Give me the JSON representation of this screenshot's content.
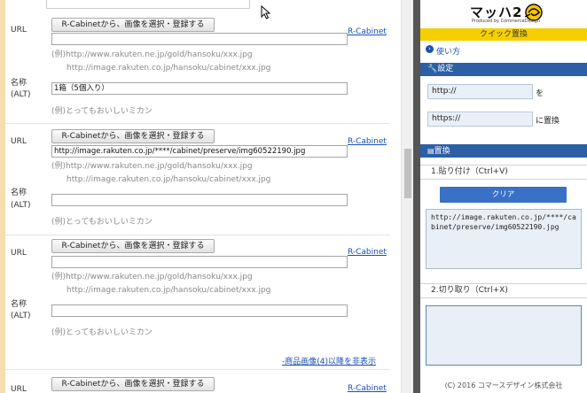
{
  "left": {
    "url_label": "URL",
    "alt_label_line1": "名称",
    "alt_label_line2": "(ALT)",
    "rc_button": "R-Cabinetから、画像を選択・登録する",
    "rc_link": "R-Cabinet",
    "example_url_1": "(例)http://www.rakuten.ne.jp/gold/hansoku/xxx.jpg",
    "example_url_2": "http://image.rakuten.co.jp/hansoku/cabinet/xxx.jpg",
    "example_alt": "(例)とってもおいしいミカン",
    "block1": {
      "url_value": "",
      "alt_value": "1箱（5個入り）"
    },
    "block2": {
      "url_value": "http://image.rakuten.co.jp/****/cabinet/preserve/img60522190.jpg",
      "alt_value": ""
    },
    "block3": {
      "url_value": "",
      "alt_value": ""
    },
    "hide_link": "-商品画像(4)以降を非表示"
  },
  "right": {
    "logo": "マッハ2",
    "logo_sub": "Produced by CommerceDesign",
    "quick_title": "クイック置換",
    "howto": "使い方",
    "settings_header": "設定",
    "find_value": "http://",
    "find_suffix": "を",
    "replace_value": "https://",
    "replace_suffix": "に置換",
    "replace_header": "置換",
    "step1": "1.貼り付け（Ctrl+V)",
    "clear_button": "クリア",
    "paste_text": "http://image.rakuten.co.jp/****/cabinet/preserve/img60522190.jpg",
    "step2": "2.切り取り（Ctrl+X)",
    "output_text": "",
    "footer": "(C) 2016 コマースデザイン株式会社"
  }
}
